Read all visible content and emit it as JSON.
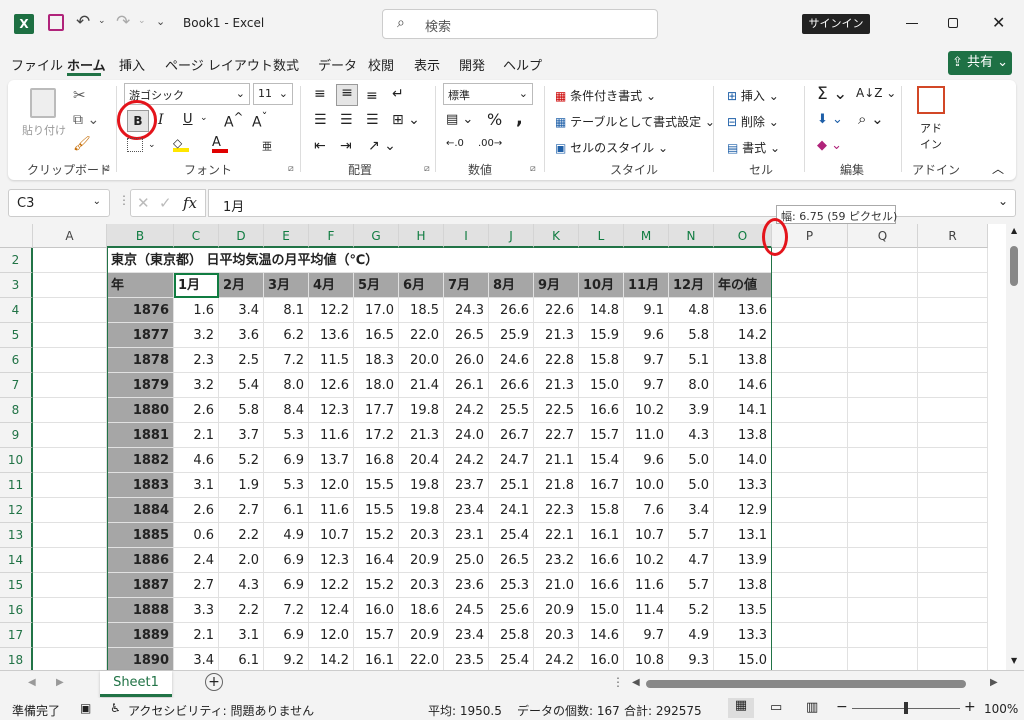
{
  "titlebar": {
    "autosave": "",
    "book_title": "Book1  -  Excel",
    "search_placeholder": "検索",
    "signin": "サインイン"
  },
  "menu": [
    "ファイル",
    "ホーム",
    "挿入",
    "ページ レイアウト",
    "数式",
    "データ",
    "校閲",
    "表示",
    "開発",
    "ヘルプ"
  ],
  "share": "共有",
  "ribbon": {
    "clipboard": {
      "paste": "貼り付け",
      "label": "クリップボード"
    },
    "font": {
      "name": "游ゴシック",
      "size": "11",
      "bold": "B",
      "italic": "I",
      "underline": "U",
      "label": "フォント"
    },
    "alignment": {
      "label": "配置"
    },
    "number": {
      "format": "標準",
      "label": "数値"
    },
    "styles": {
      "conditional": "条件付き書式",
      "table": "テーブルとして書式設定",
      "cell_style": "セルのスタイル",
      "label": "スタイル"
    },
    "cells": {
      "insert": "挿入",
      "delete": "削除",
      "format": "書式",
      "label": "セル"
    },
    "editing": {
      "label": "編集"
    },
    "addins": {
      "addin": "アド\nイン",
      "label": "アドイン"
    }
  },
  "formula_bar": {
    "name_box": "C3",
    "formula": "1月",
    "fx": "fx"
  },
  "tooltip": "幅: 6.75 (59 ピクセル)",
  "columns": [
    "A",
    "B",
    "C",
    "D",
    "E",
    "F",
    "G",
    "H",
    "I",
    "J",
    "K",
    "L",
    "M",
    "N",
    "O",
    "P",
    "Q",
    "R"
  ],
  "sheet": {
    "title": "東京（東京都）  日平均気温の月平均値（℃）",
    "header_year": "年",
    "months": [
      "1月",
      "2月",
      "3月",
      "4月",
      "5月",
      "6月",
      "7月",
      "8月",
      "9月",
      "10月",
      "11月",
      "12月",
      "年の値"
    ],
    "rows": [
      {
        "r": "4",
        "y": "1876",
        "v": [
          "1.6",
          "3.4",
          "8.1",
          "12.2",
          "17.0",
          "18.5",
          "24.3",
          "26.6",
          "22.6",
          "14.8",
          "9.1",
          "4.8",
          "13.6"
        ]
      },
      {
        "r": "5",
        "y": "1877",
        "v": [
          "3.2",
          "3.6",
          "6.2",
          "13.6",
          "16.5",
          "22.0",
          "26.5",
          "25.9",
          "21.3",
          "15.9",
          "9.6",
          "5.8",
          "14.2"
        ]
      },
      {
        "r": "6",
        "y": "1878",
        "v": [
          "2.3",
          "2.5",
          "7.2",
          "11.5",
          "18.3",
          "20.0",
          "26.0",
          "24.6",
          "22.8",
          "15.8",
          "9.7",
          "5.1",
          "13.8"
        ]
      },
      {
        "r": "7",
        "y": "1879",
        "v": [
          "3.2",
          "5.4",
          "8.0",
          "12.6",
          "18.0",
          "21.4",
          "26.1",
          "26.6",
          "21.3",
          "15.0",
          "9.7",
          "8.0",
          "14.6"
        ]
      },
      {
        "r": "8",
        "y": "1880",
        "v": [
          "2.6",
          "5.8",
          "8.4",
          "12.3",
          "17.7",
          "19.8",
          "24.2",
          "25.5",
          "22.5",
          "16.6",
          "10.2",
          "3.9",
          "14.1"
        ]
      },
      {
        "r": "9",
        "y": "1881",
        "v": [
          "2.1",
          "3.7",
          "5.3",
          "11.6",
          "17.2",
          "21.3",
          "24.0",
          "26.7",
          "22.7",
          "15.7",
          "11.0",
          "4.3",
          "13.8"
        ]
      },
      {
        "r": "10",
        "y": "1882",
        "v": [
          "4.6",
          "5.2",
          "6.9",
          "13.7",
          "16.8",
          "20.4",
          "24.2",
          "24.7",
          "21.1",
          "15.4",
          "9.6",
          "5.0",
          "14.0"
        ]
      },
      {
        "r": "11",
        "y": "1883",
        "v": [
          "3.1",
          "1.9",
          "5.3",
          "12.0",
          "15.5",
          "19.8",
          "23.7",
          "25.1",
          "21.8",
          "16.7",
          "10.0",
          "5.0",
          "13.3"
        ]
      },
      {
        "r": "12",
        "y": "1884",
        "v": [
          "2.6",
          "2.7",
          "6.1",
          "11.6",
          "15.5",
          "19.8",
          "23.4",
          "24.1",
          "22.3",
          "15.8",
          "7.6",
          "3.4",
          "12.9"
        ]
      },
      {
        "r": "13",
        "y": "1885",
        "v": [
          "0.6",
          "2.2",
          "4.9",
          "10.7",
          "15.2",
          "20.3",
          "23.1",
          "25.4",
          "22.1",
          "16.1",
          "10.7",
          "5.7",
          "13.1"
        ]
      },
      {
        "r": "14",
        "y": "1886",
        "v": [
          "2.4",
          "2.0",
          "6.9",
          "12.3",
          "16.4",
          "20.9",
          "25.0",
          "26.5",
          "23.2",
          "16.6",
          "10.2",
          "4.7",
          "13.9"
        ]
      },
      {
        "r": "15",
        "y": "1887",
        "v": [
          "2.7",
          "4.3",
          "6.9",
          "12.2",
          "15.2",
          "20.3",
          "23.6",
          "25.3",
          "21.0",
          "16.6",
          "11.6",
          "5.7",
          "13.8"
        ]
      },
      {
        "r": "16",
        "y": "1888",
        "v": [
          "3.3",
          "2.2",
          "7.2",
          "12.4",
          "16.0",
          "18.6",
          "24.5",
          "25.6",
          "20.9",
          "15.0",
          "11.4",
          "5.2",
          "13.5"
        ]
      },
      {
        "r": "17",
        "y": "1889",
        "v": [
          "2.1",
          "3.1",
          "6.9",
          "12.0",
          "15.7",
          "20.9",
          "23.4",
          "25.8",
          "20.3",
          "14.6",
          "9.7",
          "4.9",
          "13.3"
        ]
      },
      {
        "r": "18",
        "y": "1890",
        "v": [
          "3.4",
          "6.1",
          "9.2",
          "14.2",
          "16.1",
          "22.0",
          "23.5",
          "25.4",
          "24.2",
          "16.0",
          "10.8",
          "9.3",
          "15.0"
        ]
      }
    ]
  },
  "sheet_tab": "Sheet1",
  "status": {
    "ready": "準備完了",
    "accessibility": "アクセシビリティ: 問題ありません",
    "average": "平均: 1950.5",
    "count": "データの個数: 167",
    "sum": "合計: 292575",
    "zoom": "100%"
  }
}
